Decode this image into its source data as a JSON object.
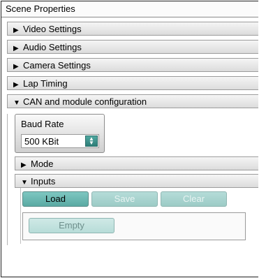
{
  "title": "Scene Properties",
  "sections": [
    {
      "label": "Video Settings",
      "arrow": "▶"
    },
    {
      "label": "Audio Settings",
      "arrow": "▶"
    },
    {
      "label": "Camera Settings",
      "arrow": "▶"
    },
    {
      "label": "Lap Timing",
      "arrow": "▶"
    },
    {
      "label": "CAN and module configuration",
      "arrow": "▼"
    }
  ],
  "can": {
    "baud_label": "Baud Rate",
    "baud_value": "500 KBit",
    "mode": {
      "label": "Mode",
      "arrow": "▶"
    },
    "inputs": {
      "label": "Inputs",
      "arrow": "▼",
      "load": "Load",
      "save": "Save",
      "clear": "Clear",
      "empty": "Empty"
    }
  }
}
